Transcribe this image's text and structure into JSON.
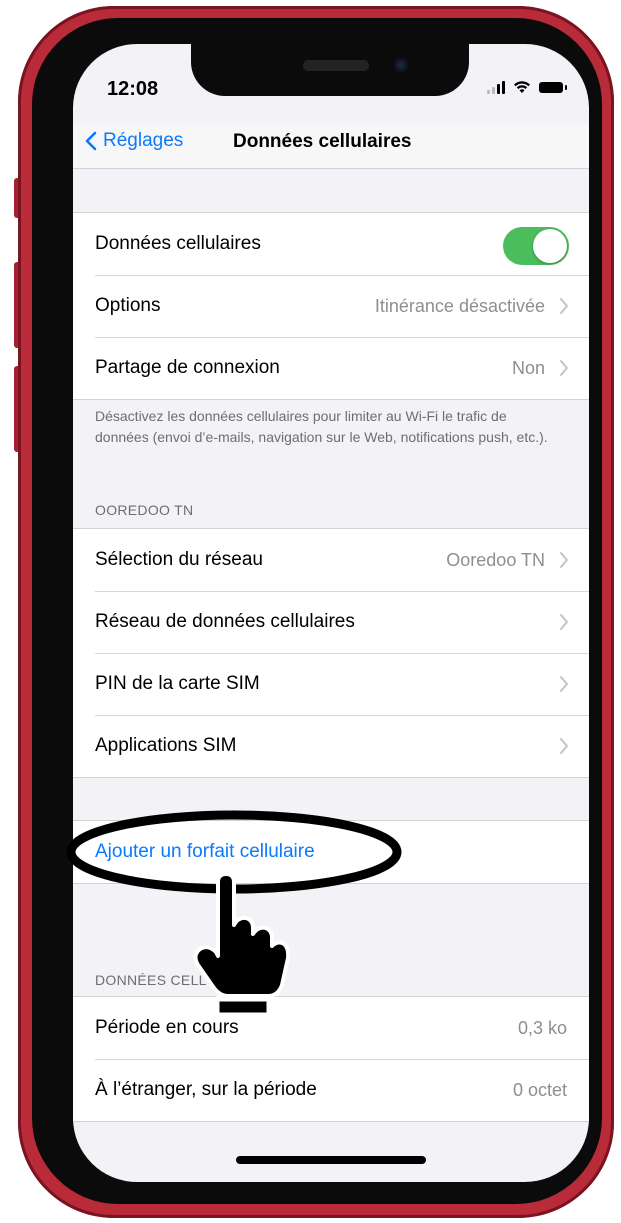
{
  "status_bar": {
    "time": "12:08"
  },
  "navbar": {
    "back_label": "Réglages",
    "title": "Données cellulaires"
  },
  "group1": {
    "cellular_data_label": "Données cellulaires",
    "cellular_data_on": true,
    "options_label": "Options",
    "options_value": "Itinérance désactivée",
    "hotspot_label": "Partage de connexion",
    "hotspot_value": "Non"
  },
  "footer_note": "Désactivez les données cellulaires pour limiter au Wi-Fi le trafic de données (envoi d’e-mails, navigation sur le Web, notifications push, etc.).",
  "carrier_section": {
    "header": "OOREDOO TN",
    "network_selection_label": "Sélection du réseau",
    "network_selection_value": "Ooredoo TN",
    "cellular_network_label": "Réseau de données cellulaires",
    "sim_pin_label": "PIN de la carte SIM",
    "sim_apps_label": "Applications SIM"
  },
  "add_plan_label": "Ajouter un forfait cellulaire",
  "usage_section": {
    "header": "DONNÉES CELLULAIRES",
    "current_period_label": "Période en cours",
    "current_period_value": "0,3 ko",
    "roaming_period_label": "À l’étranger, sur la période",
    "roaming_period_value": "0 octet"
  },
  "colors": {
    "accent": "#0a7aff",
    "toggle_on": "#4cbd5d",
    "phone_frame": "#b92b39"
  }
}
